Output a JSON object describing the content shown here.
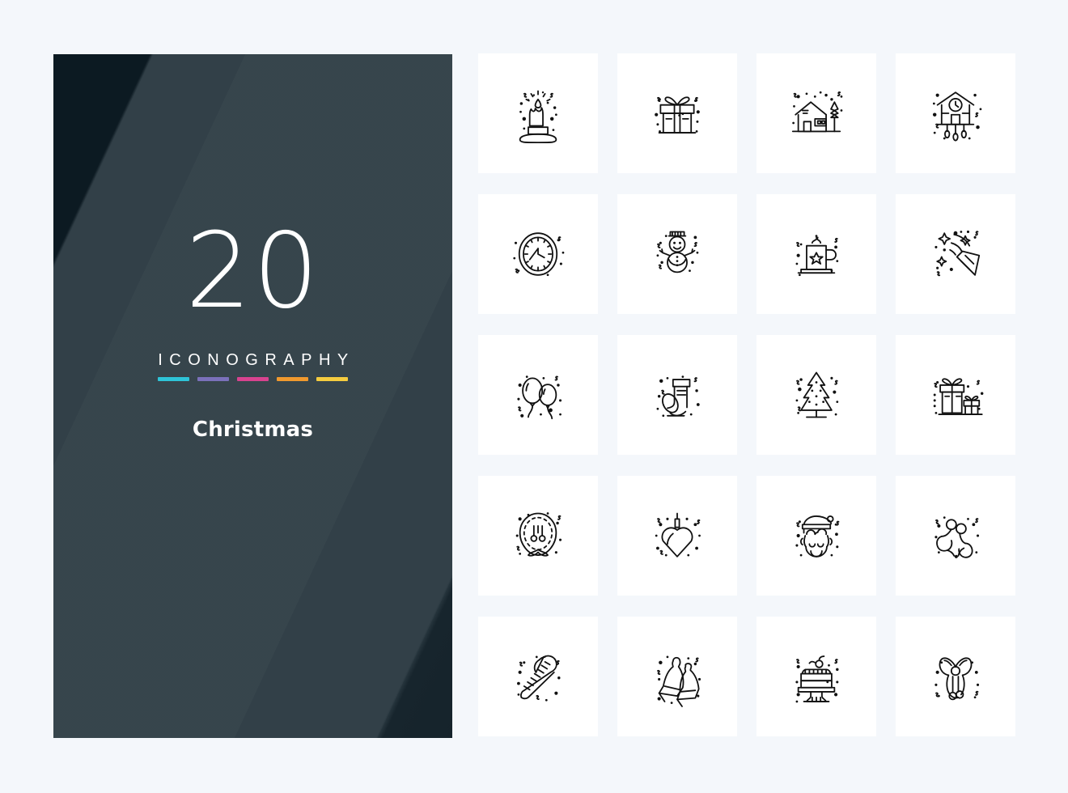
{
  "background_color": "#f4f7fb",
  "cover": {
    "background_color": "#2b3a42",
    "count": "20",
    "label": "ICONOGRAPHY",
    "title": "Christmas",
    "accent_bars": [
      {
        "name": "cyan",
        "color": "#2ec4d8"
      },
      {
        "name": "purple",
        "color": "#7b71bb"
      },
      {
        "name": "pink",
        "color": "#d8438f"
      },
      {
        "name": "orange",
        "color": "#f0992e"
      },
      {
        "name": "yellow",
        "color": "#f5cc3f"
      }
    ]
  },
  "grid": {
    "columns": 4,
    "rows": 5,
    "tile_background": "#ffffff",
    "icon_stroke_color": "#111111",
    "icons": [
      {
        "index": 1,
        "name": "candle-icon",
        "label": "Candle"
      },
      {
        "index": 2,
        "name": "gift-box-icon",
        "label": "Gift Box"
      },
      {
        "index": 3,
        "name": "winter-house-icon",
        "label": "Winter House"
      },
      {
        "index": 4,
        "name": "cuckoo-clock-icon",
        "label": "Cuckoo Clock"
      },
      {
        "index": 5,
        "name": "wall-clock-icon",
        "label": "Wall Clock"
      },
      {
        "index": 6,
        "name": "snowman-icon",
        "label": "Snowman"
      },
      {
        "index": 7,
        "name": "hot-drink-mug-icon",
        "label": "Hot Drink Mug"
      },
      {
        "index": 8,
        "name": "party-popper-icon",
        "label": "Party Popper"
      },
      {
        "index": 9,
        "name": "balloons-icon",
        "label": "Balloons"
      },
      {
        "index": 10,
        "name": "stocking-icon",
        "label": "Christmas Stocking"
      },
      {
        "index": 11,
        "name": "christmas-tree-icon",
        "label": "Christmas Tree"
      },
      {
        "index": 12,
        "name": "gifts-icon",
        "label": "Gifts"
      },
      {
        "index": 13,
        "name": "wreath-icon",
        "label": "Wreath"
      },
      {
        "index": 14,
        "name": "heart-ornament-icon",
        "label": "Heart Ornament"
      },
      {
        "index": 15,
        "name": "santa-claus-icon",
        "label": "Santa Claus"
      },
      {
        "index": 16,
        "name": "mistletoe-icon",
        "label": "Mistletoe"
      },
      {
        "index": 17,
        "name": "candy-cane-icon",
        "label": "Candy Cane"
      },
      {
        "index": 18,
        "name": "bells-icon",
        "label": "Bells"
      },
      {
        "index": 19,
        "name": "christmas-cake-icon",
        "label": "Christmas Cake"
      },
      {
        "index": 20,
        "name": "ribbon-bow-icon",
        "label": "Ribbon Bow"
      }
    ]
  }
}
